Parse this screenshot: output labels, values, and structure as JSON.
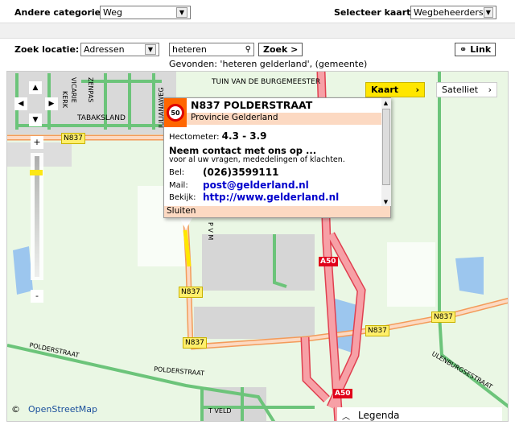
{
  "header": {
    "category_label": "Andere categorie:",
    "category_value": "Weg",
    "map_label": "Selecteer kaart:",
    "map_value": "Wegbeheerders"
  },
  "search": {
    "label": "Zoek locatie:",
    "type_value": "Adressen",
    "query": "heteren",
    "button": "Zoek >",
    "result": "Gevonden: 'heteren gelderland', (gemeente)",
    "link_button": "Link"
  },
  "map": {
    "type_buttons": {
      "kaart": "Kaart",
      "satelliet": "Satelliet"
    },
    "zoom_in": "+",
    "zoom_out": "-",
    "labels": {
      "tuin": "TUIN VAN DE BURGEMEESTER",
      "tabaksland": "TABAKSLAND",
      "julianaweg": "JULIANAWEG",
      "kerk": "KERK",
      "vicarie": "VICARIE",
      "zenpas": "ZENPAS",
      "polder1": "POLDERSTRAAT",
      "polder2": "POLDERSTRAAT",
      "ulenburg": "ULENBURGSESTRAAT",
      "tveld": "T VELD",
      "pvm": "P V M"
    },
    "shields": [
      "N837",
      "N837",
      "N837",
      "N837",
      "N837"
    ],
    "a50": [
      "A50",
      "A50"
    ],
    "attribution": "©",
    "attribution_link": "OpenStreetMap",
    "legend": "Legenda"
  },
  "popup": {
    "speed": "50",
    "title": "N837 POLDERSTRAAT",
    "subtitle": "Provincie Gelderland",
    "hecto_label": "Hectometer:",
    "hecto_value": "4.3 - 3.9",
    "contact_title": "Neem contact met ons op ...",
    "contact_sub": "voor al uw vragen, mededelingen of klachten.",
    "bel_label": "Bel:",
    "bel_value": "(026)3599111",
    "mail_label": "Mail:",
    "mail_value": "post@gelderland.nl",
    "bekijk_label": "Bekijk:",
    "bekijk_value": "http://www.gelderland.nl",
    "close": "Sluiten"
  },
  "colors": {
    "accent": "#ffe600",
    "popup_header": "#fcd9c2",
    "speed_bg": "#ff6600"
  }
}
